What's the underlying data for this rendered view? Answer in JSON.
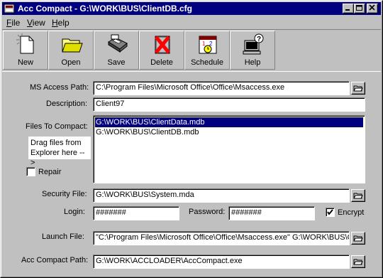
{
  "window": {
    "title": "Acc Compact - G:\\WORK\\BUS\\ClientDB.cfg"
  },
  "menu": {
    "file": "File",
    "view": "View",
    "help": "Help"
  },
  "toolbar": {
    "new": "New",
    "open": "Open",
    "save": "Save",
    "delete": "Delete",
    "schedule": "Schedule",
    "help": "Help"
  },
  "form": {
    "ms_access_path_label": "MS Access Path:",
    "ms_access_path_value": "C:\\Program Files\\Microsoft Office\\Office\\Msaccess.exe",
    "description_label": "Description:",
    "description_value": "Client97",
    "files_to_compact_label": "Files To Compact:",
    "files": [
      "G:\\WORK\\BUS\\ClientData.mdb",
      "G:\\WORK\\BUS\\ClientDB.mdb"
    ],
    "selected_file_index": 0,
    "drag_hint_line1": "Drag files from",
    "drag_hint_line2": "Explorer here -->",
    "repair_label": "Repair",
    "repair_checked": false,
    "security_file_label": "Security File:",
    "security_file_value": "G:\\WORK\\BUS\\System.mda",
    "login_label": "Login:",
    "login_value": "#######",
    "password_label": "Password:",
    "password_value": "#######",
    "encrypt_label": "Encrypt",
    "encrypt_checked": true,
    "launch_file_label": "Launch File:",
    "launch_file_value": "\"C:\\Program Files\\Microsoft Office\\Office\\Msaccess.exe\" G:\\WORK\\BUS\\C",
    "acc_compact_path_label": "Acc Compact Path:",
    "acc_compact_path_value": "G:\\WORK\\ACCLOADER\\AccCompact.exe"
  }
}
